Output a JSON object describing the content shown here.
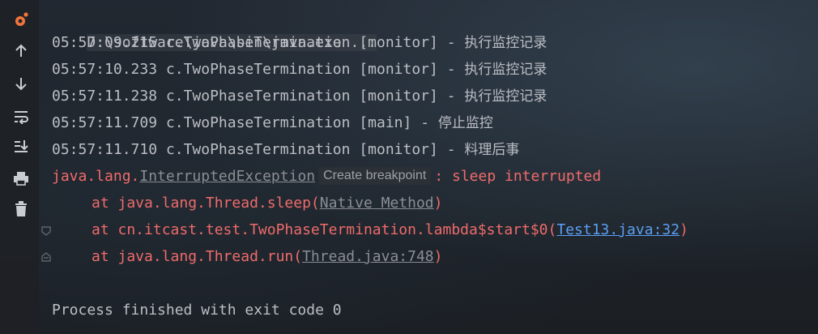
{
  "command_line": "D:\\software\\java\\bin\\java.exe ...",
  "log_lines": [
    {
      "time": "05:57:09.215",
      "logger": "c.TwoPhaseTermination",
      "thread": "[monitor]",
      "sep": "-",
      "msg": "执行监控记录"
    },
    {
      "time": "05:57:10.233",
      "logger": "c.TwoPhaseTermination",
      "thread": "[monitor]",
      "sep": "-",
      "msg": "执行监控记录"
    },
    {
      "time": "05:57:11.238",
      "logger": "c.TwoPhaseTermination",
      "thread": "[monitor]",
      "sep": "-",
      "msg": "执行监控记录"
    },
    {
      "time": "05:57:11.709",
      "logger": "c.TwoPhaseTermination",
      "thread": "[main]",
      "sep": "-",
      "msg": "停止监控"
    },
    {
      "time": "05:57:11.710",
      "logger": "c.TwoPhaseTermination",
      "thread": "[monitor]",
      "sep": "-",
      "msg": "料理后事"
    }
  ],
  "exception": {
    "package": "java.lang.",
    "class": "InterruptedException",
    "hint": "Create breakpoint",
    "message": ": sleep interrupted"
  },
  "stack": [
    {
      "prefix": "at java.lang.Thread.sleep(",
      "link": "Native Method",
      "suffix": ")"
    },
    {
      "prefix": "at cn.itcast.test.TwoPhaseTermination.lambda$start$0(",
      "link": "Test13.java:32",
      "suffix": ")"
    },
    {
      "prefix": "at java.lang.Thread.run(",
      "link": "Thread.java:748",
      "suffix": ")"
    }
  ],
  "process_finished": "Process finished with exit code 0",
  "gutter_icons": [
    "rerun-icon",
    "scroll-up-icon",
    "scroll-down-icon",
    "soft-wrap-icon",
    "scroll-to-end-icon",
    "print-icon",
    "clear-icon"
  ],
  "colors": {
    "error": "#ef6b6b",
    "link": "#5b9ff5",
    "text": "#bcbec4"
  }
}
